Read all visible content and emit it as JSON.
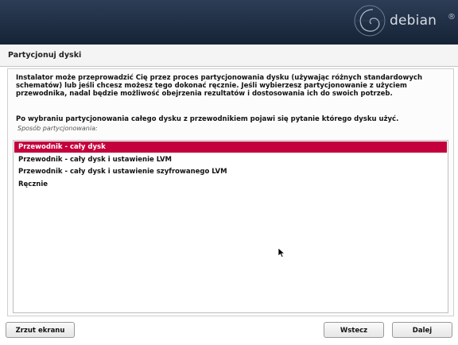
{
  "banner": {
    "logo_text": "debian",
    "logo_mark": "®",
    "logo_icon": "debian-swirl-icon"
  },
  "dialog": {
    "title": "Partycjonuj dyski",
    "description": "Instalator może przeprowadzić Cię przez proces partycjonowania dysku (używając różnych standardowych schematów) lub jeśli chcesz możesz tego dokonać ręcznie. Jeśli wybierzesz partycjonowanie z użyciem przewodnika, nadal będzie możliwość obejrzenia rezultatów i dostosowania ich do swoich potrzeb.",
    "description2": "Po wybraniu partycjonowania całego dysku z przewodnikiem pojawi się pytanie którego dysku użyć.",
    "prompt": "Sposób partycjonowania:",
    "options": [
      {
        "label": "Przewodnik - cały dysk",
        "selected": true
      },
      {
        "label": "Przewodnik - cały dysk i ustawienie LVM",
        "selected": false
      },
      {
        "label": "Przewodnik - cały dysk i ustawienie szyfrowanego LVM",
        "selected": false
      },
      {
        "label": "Ręcznie",
        "selected": false
      }
    ]
  },
  "buttons": {
    "screenshot": "Zrzut ekranu",
    "back": "Wstecz",
    "next": "Dalej"
  },
  "colors": {
    "selection": "#c4003d",
    "banner": "#1f2d42"
  }
}
